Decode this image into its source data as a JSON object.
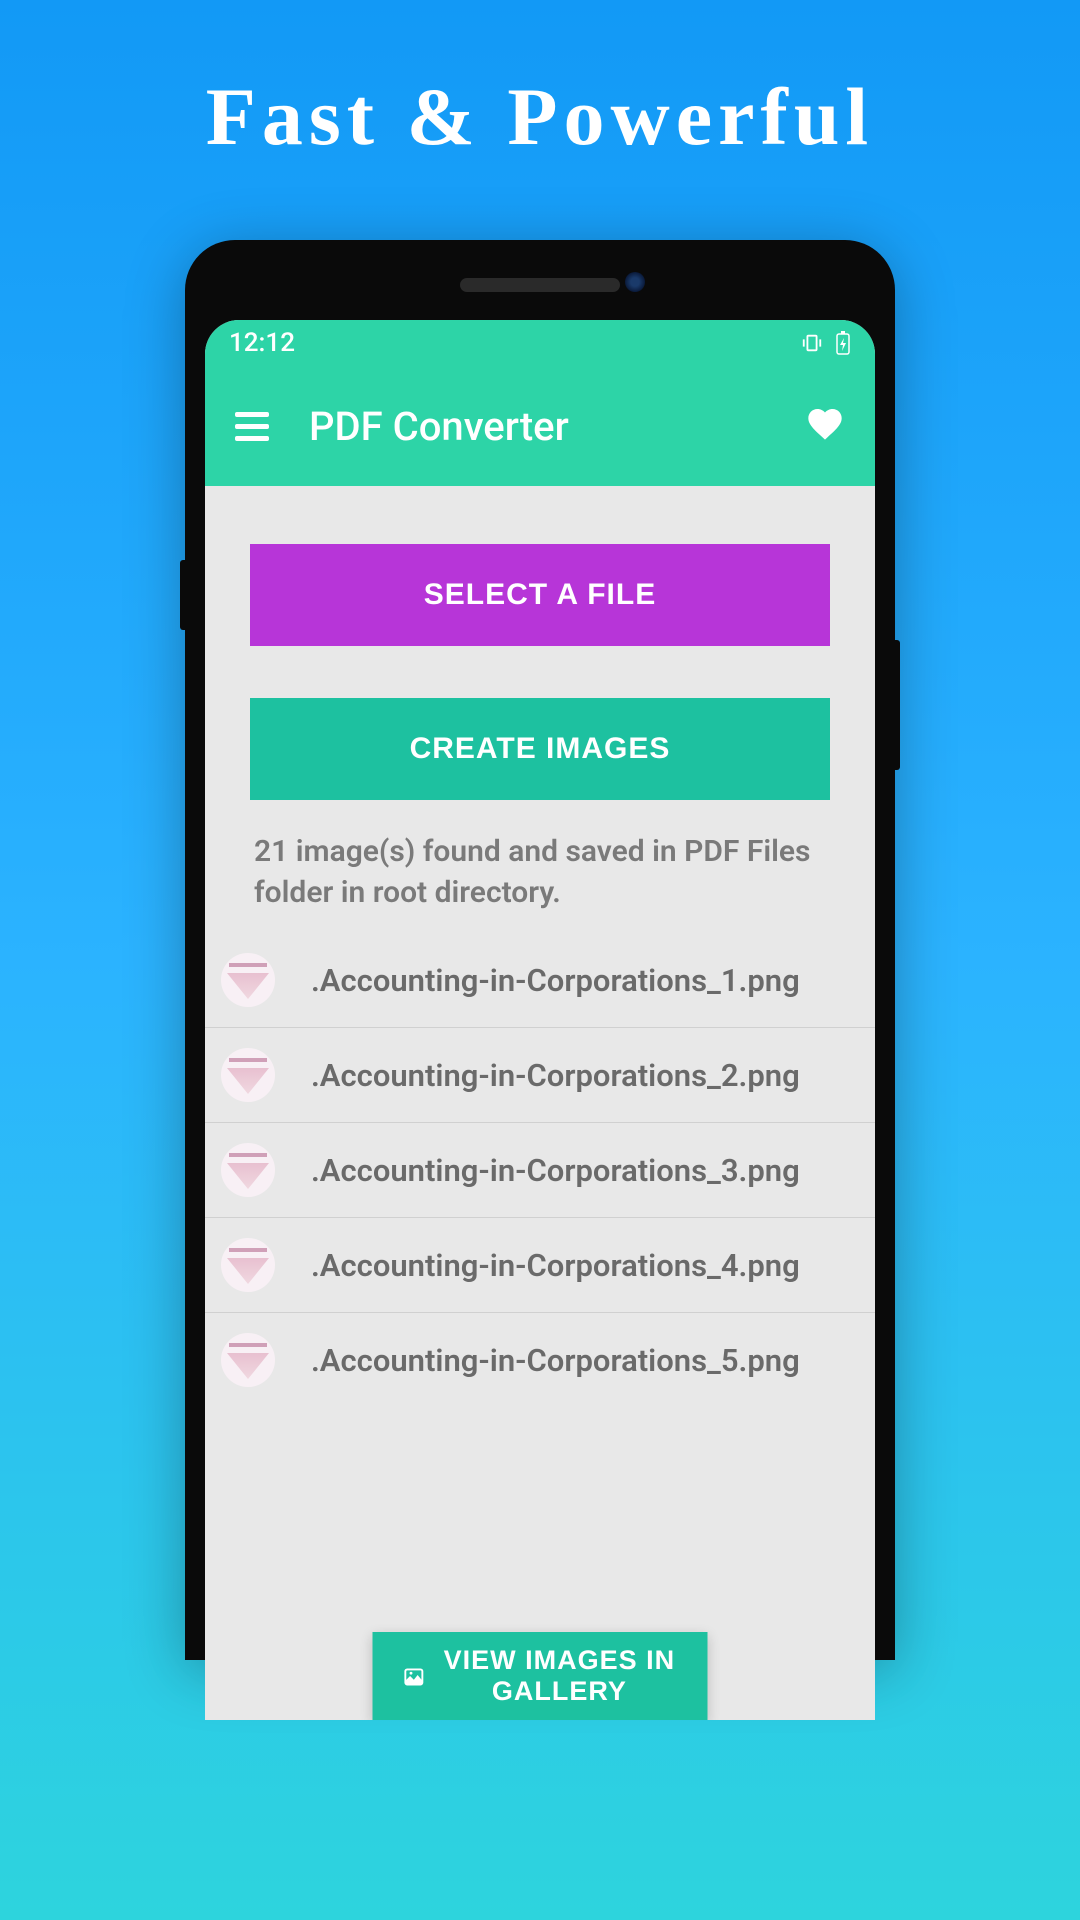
{
  "headline": "Fast & Powerful",
  "statusBar": {
    "time": "12:12"
  },
  "appBar": {
    "title": "PDF Converter"
  },
  "buttons": {
    "selectFile": "SELECT A FILE",
    "createImages": "CREATE IMAGES",
    "viewGallery": "VIEW IMAGES IN GALLERY"
  },
  "statusText": "21 image(s) found and saved in PDF Files folder in root directory.",
  "files": [
    {
      "name": ".Accounting-in-Corporations_1.png"
    },
    {
      "name": ".Accounting-in-Corporations_2.png"
    },
    {
      "name": ".Accounting-in-Corporations_3.png"
    },
    {
      "name": ".Accounting-in-Corporations_4.png"
    },
    {
      "name": ".Accounting-in-Corporations_5.png"
    }
  ]
}
